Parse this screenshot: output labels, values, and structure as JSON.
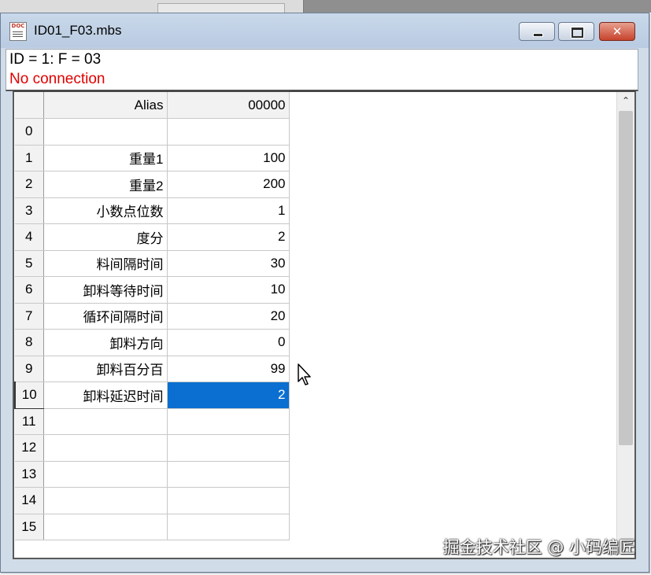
{
  "window": {
    "title": "ID01_F03.mbs",
    "controls": {
      "minimize": "minimize",
      "maximize": "maximize",
      "close": "✕"
    }
  },
  "status": {
    "id_line": "ID = 1: F = 03",
    "connection": "No connection",
    "connection_color": "#e00000"
  },
  "grid": {
    "headers": {
      "index": "",
      "alias": "Alias",
      "value": "00000"
    },
    "rows": [
      {
        "index": "0",
        "alias": "",
        "value": ""
      },
      {
        "index": "1",
        "alias": "重量1",
        "value": "100"
      },
      {
        "index": "2",
        "alias": "重量2",
        "value": "200"
      },
      {
        "index": "3",
        "alias": "小数点位数",
        "value": "1"
      },
      {
        "index": "4",
        "alias": "度分",
        "value": "2"
      },
      {
        "index": "5",
        "alias": "料间隔时间",
        "value": "30"
      },
      {
        "index": "6",
        "alias": "卸料等待时间",
        "value": "10"
      },
      {
        "index": "7",
        "alias": "循环间隔时间",
        "value": "20"
      },
      {
        "index": "8",
        "alias": "卸料方向",
        "value": "0"
      },
      {
        "index": "9",
        "alias": "卸料百分百",
        "value": "99"
      },
      {
        "index": "10",
        "alias": "卸料延迟时间",
        "value": "2"
      },
      {
        "index": "11",
        "alias": "",
        "value": ""
      },
      {
        "index": "12",
        "alias": "",
        "value": ""
      },
      {
        "index": "13",
        "alias": "",
        "value": ""
      },
      {
        "index": "14",
        "alias": "",
        "value": ""
      },
      {
        "index": "15",
        "alias": "",
        "value": ""
      }
    ],
    "selected_row": "10",
    "selection_color": "#0a6fd0"
  },
  "watermark": "掘金技术社区 @ 小码编匠"
}
